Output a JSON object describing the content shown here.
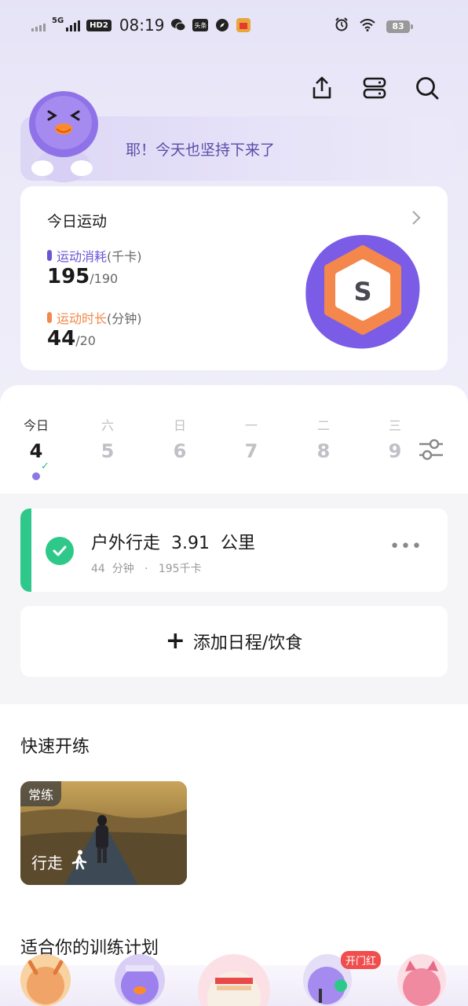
{
  "status_bar": {
    "network": "5G",
    "hd": "HD2",
    "time": "08:19",
    "app_icons": [
      "wechat-icon",
      "toutiao-icon",
      "compass-icon",
      "shop-icon"
    ],
    "toutiao_text": "头条",
    "battery": "83"
  },
  "header": {
    "icons": [
      "share-icon",
      "layout-icon",
      "search-icon"
    ]
  },
  "banner": {
    "text": "耶！今天也坚持下来了"
  },
  "today": {
    "title": "今日运动",
    "calories_label": "运动消耗",
    "calories_unit": "(千卡)",
    "calories_value": "195",
    "calories_goal": "/190",
    "duration_label": "运动时长",
    "duration_unit": "(分钟)",
    "duration_value": "44",
    "duration_goal": "/20",
    "badge_letter": "S",
    "colors": {
      "calories": "#6a55d8",
      "duration": "#f0894a",
      "badge_outer": "#7b5ce6",
      "badge_inner": "#f4874b"
    }
  },
  "week": {
    "days": [
      {
        "label": "今日",
        "number": "4"
      },
      {
        "label": "六",
        "number": "5"
      },
      {
        "label": "日",
        "number": "6"
      },
      {
        "label": "一",
        "number": "7"
      },
      {
        "label": "二",
        "number": "8"
      },
      {
        "label": "三",
        "number": "9"
      }
    ],
    "check": "✓"
  },
  "activity": {
    "title": "户外行走  3.91  公里",
    "subtitle": "44  分钟   ·   195千卡",
    "more": "•••"
  },
  "add": {
    "plus": "+",
    "label": "添加日程/饮食"
  },
  "quick": {
    "title": "快速开练",
    "tag": "常练",
    "label": "行走"
  },
  "plans": {
    "title": "适合你的训练计划",
    "hot_tag": "开门红"
  }
}
